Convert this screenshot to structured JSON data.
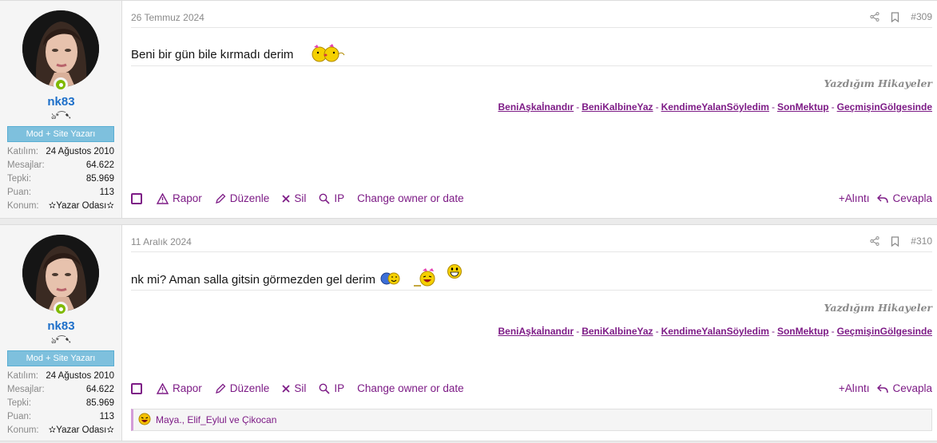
{
  "posts": [
    {
      "user": {
        "name": "nk83",
        "signature_glyphs": "ঌ*⁀➷",
        "banner": "Mod + Site Yazarı",
        "stats": [
          {
            "k": "Katılım:",
            "v": "24 Ağustos 2010"
          },
          {
            "k": "Mesajlar:",
            "v": "64.622"
          },
          {
            "k": "Tepki:",
            "v": "85.969"
          },
          {
            "k": "Puan:",
            "v": "113"
          },
          {
            "k": "Konum:",
            "v": "✫Yazar Odası✫"
          }
        ]
      },
      "date": "26 Temmuz 2024",
      "number": "#309",
      "message": "Beni bir gün bile kırmadı derim"
    },
    {
      "user": {
        "name": "nk83",
        "signature_glyphs": "ঌ*⁀➷",
        "banner": "Mod + Site Yazarı",
        "stats": [
          {
            "k": "Katılım:",
            "v": "24 Ağustos 2010"
          },
          {
            "k": "Mesajlar:",
            "v": "64.622"
          },
          {
            "k": "Tepki:",
            "v": "85.969"
          },
          {
            "k": "Puan:",
            "v": "113"
          },
          {
            "k": "Konum:",
            "v": "✫Yazar Odası✫"
          }
        ]
      },
      "date": "11 Aralık 2024",
      "number": "#310",
      "message": "nk mi? Aman salla gitsin görmezden gel derim",
      "reactions": "Maya., Elif_Eylul ve Çikocan"
    }
  ],
  "signature": {
    "title": "Yazdığım Hikayeler",
    "links": [
      "BeniAşkaİnandır",
      "BeniKalbineYaz",
      "KendimeYalanSöyledim",
      "SonMektup",
      "GeçmişinGölgesinde"
    ]
  },
  "actions": {
    "report": "Rapor",
    "edit": "Düzenle",
    "delete": "Sil",
    "ip": "IP",
    "change_owner": "Change owner or date",
    "quote": "+Alıntı",
    "reply": "Cevapla"
  },
  "colors": {
    "accent": "#7d1b86",
    "username": "#1d6fc9",
    "banner": "#7ec0dd",
    "online": "#7fb900"
  },
  "icons": [
    "share-icon",
    "bookmark-icon",
    "warning-icon",
    "pencil-icon",
    "close-icon",
    "search-icon",
    "reply-icon",
    "laughing-icon"
  ]
}
